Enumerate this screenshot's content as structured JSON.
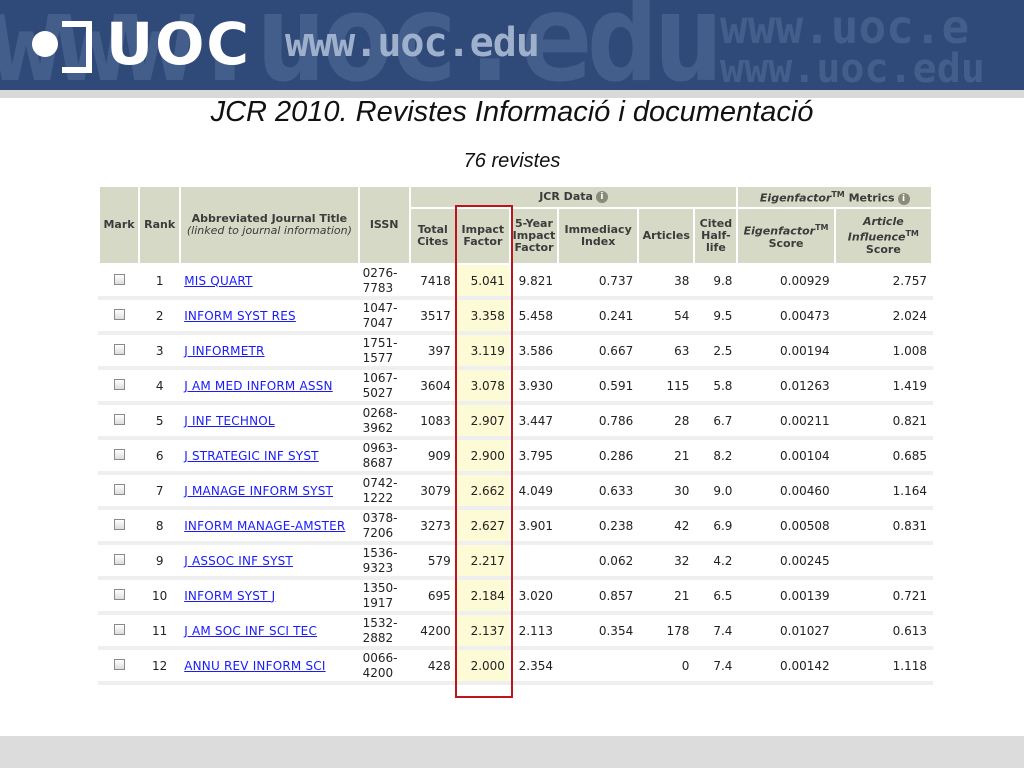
{
  "banner": {
    "logo_text": "UOC",
    "url_text": "www.uoc.edu",
    "watermark_big": "www.uoc.edu",
    "watermark_right_1": "www.uoc.e",
    "watermark_right_2": "www.uoc.edu"
  },
  "title": "JCR 2010. Revistes Informació i documentació",
  "subtitle": "76 revistes",
  "table": {
    "headers": {
      "mark": "Mark",
      "rank": "Rank",
      "title_main": "Abbreviated Journal Title",
      "title_sub": "(linked to journal information)",
      "issn": "ISSN",
      "jcr_group": "JCR Data",
      "eigen_group": "Eigenfactor",
      "eigen_group_tm": "TM",
      "eigen_group_suffix": " Metrics",
      "total_cites": "Total Cites",
      "impact_factor": "Impact Factor",
      "five_year": "5-Year Impact Factor",
      "immediacy": "Immediacy Index",
      "articles": "Articles",
      "cited_half_life": "Cited Half-life",
      "eigen_score_a": "Eigenfactor",
      "eigen_score_tm": "TM",
      "eigen_score_b": "Score",
      "aiscore_a": "Article Influence",
      "aiscore_tm": "TM",
      "aiscore_b": "Score"
    },
    "rows": [
      {
        "rank": "1",
        "title": "MIS QUART",
        "issn1": "0276-",
        "issn2": "7783",
        "cites": "7418",
        "if": "5.041",
        "fy": "9.821",
        "imm": "0.737",
        "art": "38",
        "hl": "9.8",
        "ef": "0.00929",
        "ai": "2.757"
      },
      {
        "rank": "2",
        "title": "INFORM SYST RES",
        "issn1": "1047-",
        "issn2": "7047",
        "cites": "3517",
        "if": "3.358",
        "fy": "5.458",
        "imm": "0.241",
        "art": "54",
        "hl": "9.5",
        "ef": "0.00473",
        "ai": "2.024"
      },
      {
        "rank": "3",
        "title": "J INFORMETR",
        "issn1": "1751-",
        "issn2": "1577",
        "cites": "397",
        "if": "3.119",
        "fy": "3.586",
        "imm": "0.667",
        "art": "63",
        "hl": "2.5",
        "ef": "0.00194",
        "ai": "1.008"
      },
      {
        "rank": "4",
        "title": "J AM MED INFORM ASSN",
        "issn1": "1067-",
        "issn2": "5027",
        "cites": "3604",
        "if": "3.078",
        "fy": "3.930",
        "imm": "0.591",
        "art": "115",
        "hl": "5.8",
        "ef": "0.01263",
        "ai": "1.419"
      },
      {
        "rank": "5",
        "title": "J INF TECHNOL",
        "issn1": "0268-",
        "issn2": "3962",
        "cites": "1083",
        "if": "2.907",
        "fy": "3.447",
        "imm": "0.786",
        "art": "28",
        "hl": "6.7",
        "ef": "0.00211",
        "ai": "0.821"
      },
      {
        "rank": "6",
        "title": "J STRATEGIC INF SYST",
        "issn1": "0963-",
        "issn2": "8687",
        "cites": "909",
        "if": "2.900",
        "fy": "3.795",
        "imm": "0.286",
        "art": "21",
        "hl": "8.2",
        "ef": "0.00104",
        "ai": "0.685"
      },
      {
        "rank": "7",
        "title": "J MANAGE INFORM SYST",
        "issn1": "0742-",
        "issn2": "1222",
        "cites": "3079",
        "if": "2.662",
        "fy": "4.049",
        "imm": "0.633",
        "art": "30",
        "hl": "9.0",
        "ef": "0.00460",
        "ai": "1.164"
      },
      {
        "rank": "8",
        "title": "INFORM MANAGE-AMSTER",
        "issn1": "0378-",
        "issn2": "7206",
        "cites": "3273",
        "if": "2.627",
        "fy": "3.901",
        "imm": "0.238",
        "art": "42",
        "hl": "6.9",
        "ef": "0.00508",
        "ai": "0.831"
      },
      {
        "rank": "9",
        "title": "J ASSOC INF SYST",
        "issn1": "1536-",
        "issn2": "9323",
        "cites": "579",
        "if": "2.217",
        "fy": "",
        "imm": "0.062",
        "art": "32",
        "hl": "4.2",
        "ef": "0.00245",
        "ai": ""
      },
      {
        "rank": "10",
        "title": "INFORM SYST J",
        "issn1": "1350-",
        "issn2": "1917",
        "cites": "695",
        "if": "2.184",
        "fy": "3.020",
        "imm": "0.857",
        "art": "21",
        "hl": "6.5",
        "ef": "0.00139",
        "ai": "0.721"
      },
      {
        "rank": "11",
        "title": "J AM SOC INF SCI TEC",
        "issn1": "1532-",
        "issn2": "2882",
        "cites": "4200",
        "if": "2.137",
        "fy": "2.113",
        "imm": "0.354",
        "art": "178",
        "hl": "7.4",
        "ef": "0.01027",
        "ai": "0.613"
      },
      {
        "rank": "12",
        "title": "ANNU REV INFORM SCI",
        "issn1": "0066-",
        "issn2": "4200",
        "cites": "428",
        "if": "2.000",
        "fy": "2.354",
        "imm": "",
        "art": "0",
        "hl": "7.4",
        "ef": "0.00142",
        "ai": "1.118"
      }
    ]
  },
  "colors": {
    "banner": "#2f4a78",
    "header_bg": "#d5d9c5",
    "impact_highlight": "#fdfbd6",
    "highlight_border": "#c0141c",
    "link": "#1a1aff"
  },
  "icons": {
    "info": "info-icon",
    "checkbox": "checkbox"
  }
}
